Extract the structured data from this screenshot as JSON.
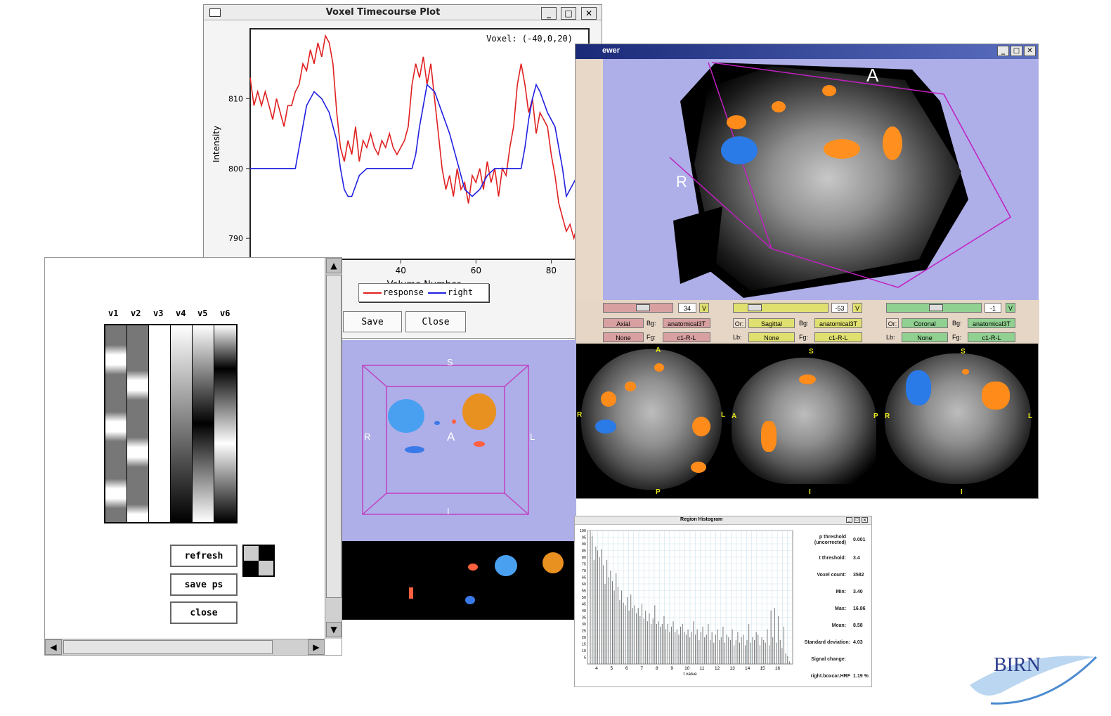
{
  "timecourse": {
    "title": "Voxel Timecourse Plot",
    "voxel_label": "Voxel: (-40,0,20)",
    "save_label": "Save",
    "close_label": "Close"
  },
  "viewer": {
    "title": "ewer",
    "labels": {
      "A": "A",
      "R": "R",
      "S": "S",
      "I": "I",
      "L": "L",
      "P": "P"
    },
    "controls": [
      {
        "value": "34",
        "v": "V",
        "orient": "Axial",
        "bg": "Bg:",
        "bg_val": "anatomical3T",
        "lb_val": "None",
        "fg": "Fg:",
        "fg_val": "c1-R-L",
        "color": "#d8a0a0"
      },
      {
        "value": "-53",
        "v": "V",
        "or": "Or:",
        "orient": "Sagittal",
        "bg": "Bg:",
        "bg_val": "anatomical3T",
        "lb": "Lb:",
        "lb_val": "None",
        "fg": "Fg:",
        "fg_val": "c1-R-L",
        "color": "#e0e070"
      },
      {
        "value": "-1",
        "v": "V",
        "or": "Or:",
        "orient": "Coronal",
        "bg": "Bg:",
        "bg_val": "anatomical3T",
        "lb": "Lb:",
        "lb_val": "None",
        "fg": "Fg:",
        "fg_val": "c1-R-L",
        "color": "#90d090"
      }
    ]
  },
  "regressors": {
    "columns": [
      "v1",
      "v2",
      "v3",
      "v4",
      "v5",
      "v6"
    ],
    "refresh_label": "refresh",
    "saveps_label": "save ps",
    "close_label": "close"
  },
  "histogram": {
    "title": "Region Histogram",
    "stats": [
      {
        "label": "p threshold\n(uncorrected)",
        "value": "0.001"
      },
      {
        "label": "t threshold:",
        "value": "3.4"
      },
      {
        "label": "Voxel count:",
        "value": "3582"
      },
      {
        "label": "Min:",
        "value": "3.40"
      },
      {
        "label": "Max:",
        "value": "16.86"
      },
      {
        "label": "Mean:",
        "value": "8.58"
      },
      {
        "label": "Standard deviation:",
        "value": "4.03"
      },
      {
        "label": "Signal change:",
        "value": ""
      },
      {
        "label": "right.boxcar.HRF",
        "value": "1.19 %"
      }
    ]
  },
  "logo": {
    "text": "BIRN",
    "color": "#2a3c8c"
  },
  "chart_data": [
    {
      "type": "line",
      "title": "",
      "xlabel": "Volume Number",
      "ylabel": "Intensity",
      "xlim": [
        0,
        90
      ],
      "ylim": [
        787,
        820
      ],
      "xticks": [
        40,
        60,
        80
      ],
      "yticks": [
        790,
        800,
        810
      ],
      "series": [
        {
          "name": "response",
          "color": "#e02020",
          "x": [
            0,
            1,
            2,
            3,
            4,
            5,
            6,
            7,
            8,
            9,
            10,
            11,
            12,
            13,
            14,
            15,
            16,
            17,
            18,
            19,
            20,
            21,
            22,
            23,
            24,
            25,
            26,
            27,
            28,
            29,
            30,
            31,
            32,
            33,
            34,
            35,
            36,
            37,
            38,
            39,
            40,
            41,
            42,
            43,
            44,
            45,
            46,
            47,
            48,
            49,
            50,
            51,
            52,
            53,
            54,
            55,
            56,
            57,
            58,
            59,
            60,
            61,
            62,
            63,
            64,
            65,
            66,
            67,
            68,
            69,
            70,
            71,
            72,
            73,
            74,
            75,
            76,
            77,
            78,
            79,
            80,
            81,
            82,
            83,
            84,
            85,
            86,
            87,
            88,
            89,
            90
          ],
          "y": [
            813,
            809,
            811,
            809,
            811,
            809,
            807,
            810,
            808,
            806,
            809,
            809,
            811,
            812,
            815,
            814,
            817,
            815,
            818,
            816,
            819,
            818,
            815,
            808,
            803,
            801,
            804,
            802,
            806,
            801,
            804,
            803,
            805,
            803,
            802,
            804,
            803,
            805,
            803,
            802,
            803,
            804,
            806,
            812,
            815,
            813,
            816,
            812,
            815,
            810,
            805,
            800,
            797,
            799,
            796,
            800,
            797,
            798,
            795,
            799,
            798,
            800,
            797,
            801,
            798,
            800,
            796,
            800,
            799,
            803,
            806,
            812,
            815,
            812,
            808,
            810,
            805,
            808,
            807,
            806,
            802,
            799,
            795,
            793,
            791,
            792,
            790,
            792,
            789,
            792,
            790
          ]
        },
        {
          "name": "right",
          "color": "#2020e0",
          "x": [
            0,
            5,
            10,
            11,
            12,
            13,
            15,
            17,
            19,
            21,
            23,
            24,
            25,
            26,
            27,
            29,
            31,
            33,
            35,
            37,
            39,
            41,
            43,
            44,
            45,
            46,
            47,
            49,
            51,
            53,
            55,
            57,
            59,
            61,
            63,
            65,
            67,
            69,
            71,
            72,
            73,
            74,
            75,
            76,
            77,
            79,
            81,
            83,
            84,
            85,
            86,
            88,
            90
          ],
          "y": [
            800,
            800,
            800,
            800,
            800,
            803,
            809,
            811,
            810,
            808,
            804,
            800,
            797,
            796,
            796,
            799,
            800,
            800,
            800,
            800,
            800,
            800,
            800,
            802,
            806,
            809,
            812,
            811,
            808,
            805,
            801,
            797,
            796,
            797,
            799,
            800,
            800,
            800,
            800,
            800,
            803,
            807,
            810,
            812,
            811,
            808,
            806,
            800,
            796,
            797,
            798,
            800,
            800
          ]
        }
      ],
      "legend": "bottom-center"
    },
    {
      "type": "bar",
      "title": "",
      "xlabel": "t value",
      "ylabel": "",
      "xlim": [
        3.4,
        17
      ],
      "xticks": [
        4,
        5,
        6,
        7,
        8,
        9,
        10,
        11,
        12,
        13,
        14,
        15,
        16
      ],
      "ylim": [
        0,
        100
      ],
      "yticks": [
        5,
        10,
        15,
        20,
        25,
        30,
        35,
        40,
        45,
        50,
        55,
        60,
        65,
        70,
        75,
        80,
        85,
        90,
        95,
        100
      ],
      "values": [
        100,
        96,
        78,
        88,
        85,
        80,
        86,
        74,
        60,
        78,
        65,
        70,
        62,
        55,
        68,
        58,
        48,
        55,
        46,
        44,
        50,
        40,
        52,
        42,
        44,
        38,
        42,
        36,
        45,
        34,
        40,
        32,
        38,
        30,
        34,
        44,
        30,
        32,
        28,
        30,
        36,
        26,
        30,
        24,
        28,
        32,
        24,
        26,
        22,
        28,
        30,
        24,
        22,
        26,
        20,
        24,
        32,
        22,
        26,
        18,
        24,
        28,
        20,
        22,
        30,
        18,
        24,
        16,
        22,
        26,
        18,
        20,
        28,
        16,
        22,
        20,
        18,
        26,
        14,
        18,
        24,
        16,
        20,
        22,
        14,
        18,
        30,
        16,
        20,
        18,
        24,
        22,
        14,
        20,
        18,
        16,
        26,
        14,
        40,
        20,
        42,
        16,
        36,
        18,
        12,
        28,
        8,
        6,
        2
      ]
    }
  ]
}
